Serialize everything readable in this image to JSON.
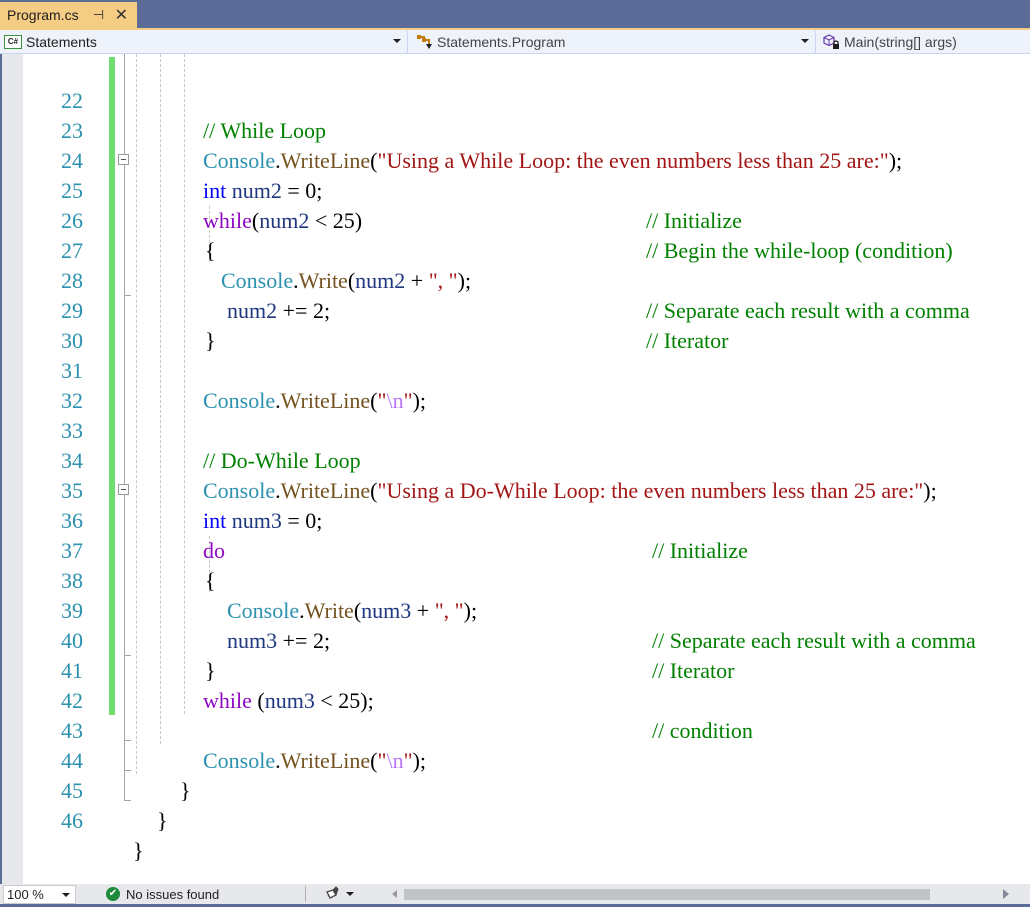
{
  "window": {
    "tab": {
      "label": "Program.cs",
      "pin_icon": "pin-icon",
      "close_icon": "close-icon"
    },
    "accent_color": "#f5cc84",
    "chrome_color": "#5d6b99"
  },
  "navbar": {
    "project": {
      "icon": "csharp-project-icon",
      "label": "Statements"
    },
    "type": {
      "icon": "class-icon",
      "label": "Statements.Program"
    },
    "member": {
      "icon": "private-method-icon",
      "label": "Main(string[] args)"
    }
  },
  "editor": {
    "lines": [
      {
        "n": "22",
        "comment": "// While Loop"
      },
      {
        "n": "23"
      },
      {
        "n": "24",
        "comment": "// Initialize"
      },
      {
        "n": "25",
        "comment": "// Begin the while-loop (condition)"
      },
      {
        "n": "26"
      },
      {
        "n": "27",
        "comment": "// Separate each result with a comma"
      },
      {
        "n": "28",
        "comment": "// Iterator"
      },
      {
        "n": "29"
      },
      {
        "n": "30"
      },
      {
        "n": "31"
      },
      {
        "n": "32"
      },
      {
        "n": "33",
        "comment": "// Do-While Loop"
      },
      {
        "n": "34"
      },
      {
        "n": "35",
        "comment": "// Initialize"
      },
      {
        "n": "36"
      },
      {
        "n": "37"
      },
      {
        "n": "38",
        "comment": "// Separate each result with a comma"
      },
      {
        "n": "39",
        "comment": "// Iterator"
      },
      {
        "n": "40"
      },
      {
        "n": "41",
        "comment": "// condition"
      },
      {
        "n": "42"
      },
      {
        "n": "43"
      },
      {
        "n": "44"
      },
      {
        "n": "45"
      },
      {
        "n": "46"
      }
    ],
    "tokens": {
      "console": "Console",
      "dot": ".",
      "writeline": "WriteLine",
      "write": "Write",
      "paren_open": "(",
      "paren_close_semi": ");",
      "str_while": "\"Using a While Loop: the even numbers less than 25 are:\"",
      "str_dowhile": "\"Using a Do-While Loop: the even numbers less than 25 are:\"",
      "kw_int": "int",
      "kw_while": "while",
      "kw_do": "do",
      "num2": "num2",
      "num3": "num3",
      "assign_zero": " = 0;",
      "lt25_close": " < 25)",
      "lt25_close_semi": " < 25);",
      "plus": " + ",
      "str_comma": "\", \"",
      "plus_eq_2": " += 2;",
      "brace_open": "{",
      "brace_close": "}",
      "quote": "\"",
      "esc_n": "\\n",
      "space_paren": " ("
    },
    "colors": {
      "line_number": "#2b91af",
      "class": "#2b91af",
      "method": "#74531f",
      "string": "#a31515",
      "keyword": "#0000ff",
      "control": "#8f08c4",
      "variable": "#1f377f",
      "comment": "#008000",
      "escape": "#b776fb",
      "change_bar": "#6fdc6f"
    }
  },
  "statusbar": {
    "zoom": "100 %",
    "issues_icon": "check-circle-icon",
    "issues_text": "No issues found",
    "cleanup_icon": "brush-icon"
  }
}
